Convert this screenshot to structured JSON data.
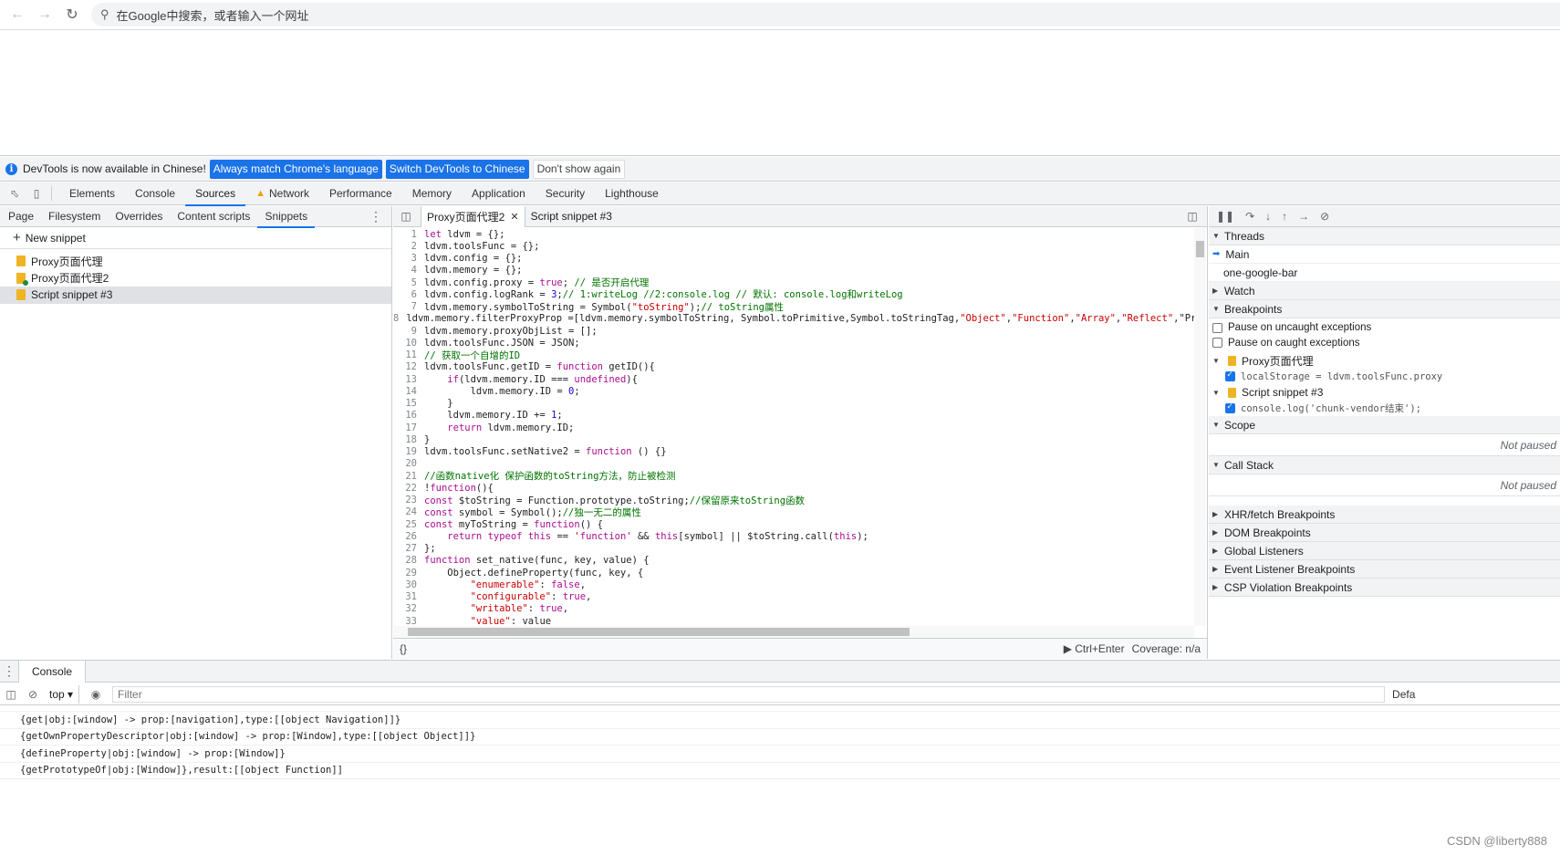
{
  "browser": {
    "omnibox_placeholder": "在Google中搜索，或者输入一个网址"
  },
  "infobar": {
    "message": "DevTools is now available in Chinese!",
    "btn_match": "Always match Chrome's language",
    "btn_switch": "Switch DevTools to Chinese",
    "btn_dismiss": "Don't show again"
  },
  "devtools_tabs": [
    "Elements",
    "Console",
    "Sources",
    "Network",
    "Performance",
    "Memory",
    "Application",
    "Security",
    "Lighthouse"
  ],
  "navigator": {
    "tabs": [
      "Page",
      "Filesystem",
      "Overrides",
      "Content scripts",
      "Snippets"
    ],
    "new_snippet": "New snippet",
    "snippets": [
      "Proxy页面代理",
      "Proxy页面代理2",
      "Script snippet #3"
    ]
  },
  "editor": {
    "tabs": [
      "Proxy页面代理2",
      "Script snippet #3"
    ],
    "code_lines": [
      {
        "n": "1",
        "t": "let ldvm = {};"
      },
      {
        "n": "2",
        "t": "ldvm.toolsFunc = {};"
      },
      {
        "n": "3",
        "t": "ldvm.config = {};"
      },
      {
        "n": "4",
        "t": "ldvm.memory = {};"
      },
      {
        "n": "5",
        "t": "ldvm.config.proxy = true; // 是否开启代理"
      },
      {
        "n": "6",
        "t": "ldvm.config.logRank = 3;// 1:writeLog //2:console.log // 默认: console.log和writeLog"
      },
      {
        "n": "7",
        "t": "ldvm.memory.symbolToString = Symbol(\"toString\");// toString属性"
      },
      {
        "n": "8",
        "t": "ldvm.memory.filterProxyProp =[ldvm.memory.symbolToString, Symbol.toPrimitive,Symbol.toStringTag,\"Object\",\"Function\",\"Array\",\"Reflect\",\"Pro"
      },
      {
        "n": "9",
        "t": "ldvm.memory.proxyObjList = [];"
      },
      {
        "n": "10",
        "t": "ldvm.toolsFunc.JSON = JSON;"
      },
      {
        "n": "11",
        "t": "// 获取一个自增的ID"
      },
      {
        "n": "12",
        "t": "ldvm.toolsFunc.getID = function getID(){"
      },
      {
        "n": "13",
        "t": "    if(ldvm.memory.ID === undefined){"
      },
      {
        "n": "14",
        "t": "        ldvm.memory.ID = 0;"
      },
      {
        "n": "15",
        "t": "    }"
      },
      {
        "n": "16",
        "t": "    ldvm.memory.ID += 1;"
      },
      {
        "n": "17",
        "t": "    return ldvm.memory.ID;"
      },
      {
        "n": "18",
        "t": "}"
      },
      {
        "n": "19",
        "t": "ldvm.toolsFunc.setNative2 = function () {}"
      },
      {
        "n": "20",
        "t": ""
      },
      {
        "n": "21",
        "t": "//函数native化 保护函数的toString方法，防止被检测"
      },
      {
        "n": "22",
        "t": "!function(){"
      },
      {
        "n": "23",
        "t": "const $toString = Function.prototype.toString;//保留原来toString函数"
      },
      {
        "n": "24",
        "t": "const symbol = Symbol();//独一无二的属性"
      },
      {
        "n": "25",
        "t": "const myToString = function() {"
      },
      {
        "n": "26",
        "t": "    return typeof this == 'function' && this[symbol] || $toString.call(this);"
      },
      {
        "n": "27",
        "t": "};"
      },
      {
        "n": "28",
        "t": "function set_native(func, key, value) {"
      },
      {
        "n": "29",
        "t": "    Object.defineProperty(func, key, {"
      },
      {
        "n": "30",
        "t": "        \"enumerable\": false,"
      },
      {
        "n": "31",
        "t": "        \"configurable\": true,"
      },
      {
        "n": "32",
        "t": "        \"writable\": true,"
      },
      {
        "n": "33",
        "t": "        \"value\": value"
      }
    ],
    "footer_braces": "{}",
    "run_hint": "Ctrl+Enter",
    "coverage": "Coverage: n/a"
  },
  "debugger": {
    "threads_label": "Threads",
    "threads": [
      "Main",
      "one-google-bar"
    ],
    "watch_label": "Watch",
    "breakpoints_label": "Breakpoints",
    "pause_uncaught": "Pause on uncaught exceptions",
    "pause_caught": "Pause on caught exceptions",
    "bp_files": [
      {
        "name": "Proxy页面代理",
        "line": "localStorage = ldvm.toolsFunc.proxy"
      },
      {
        "name": "Script snippet #3",
        "line": "console.log('chunk-vendor结束');"
      }
    ],
    "scope_label": "Scope",
    "not_paused": "Not paused",
    "callstack_label": "Call Stack",
    "not_paused2": "Not paused",
    "panes": [
      "XHR/fetch Breakpoints",
      "DOM Breakpoints",
      "Global Listeners",
      "Event Listener Breakpoints",
      "CSP Violation Breakpoints"
    ]
  },
  "console": {
    "tab": "Console",
    "context": "top",
    "filter_placeholder": "Filter",
    "levels": "Defa",
    "lines": [
      "{get|obj:[window] -> prop:[navigation],type:[[object Navigation]]}",
      "{getOwnPropertyDescriptor|obj:[window] -> prop:[Window],type:[[object Object]]}",
      "{defineProperty|obj:[window] -> prop:[Window]}",
      "{getPrototypeOf|obj:[Window]},result:[[object Function]]"
    ]
  },
  "watermark": "CSDN @liberty888"
}
